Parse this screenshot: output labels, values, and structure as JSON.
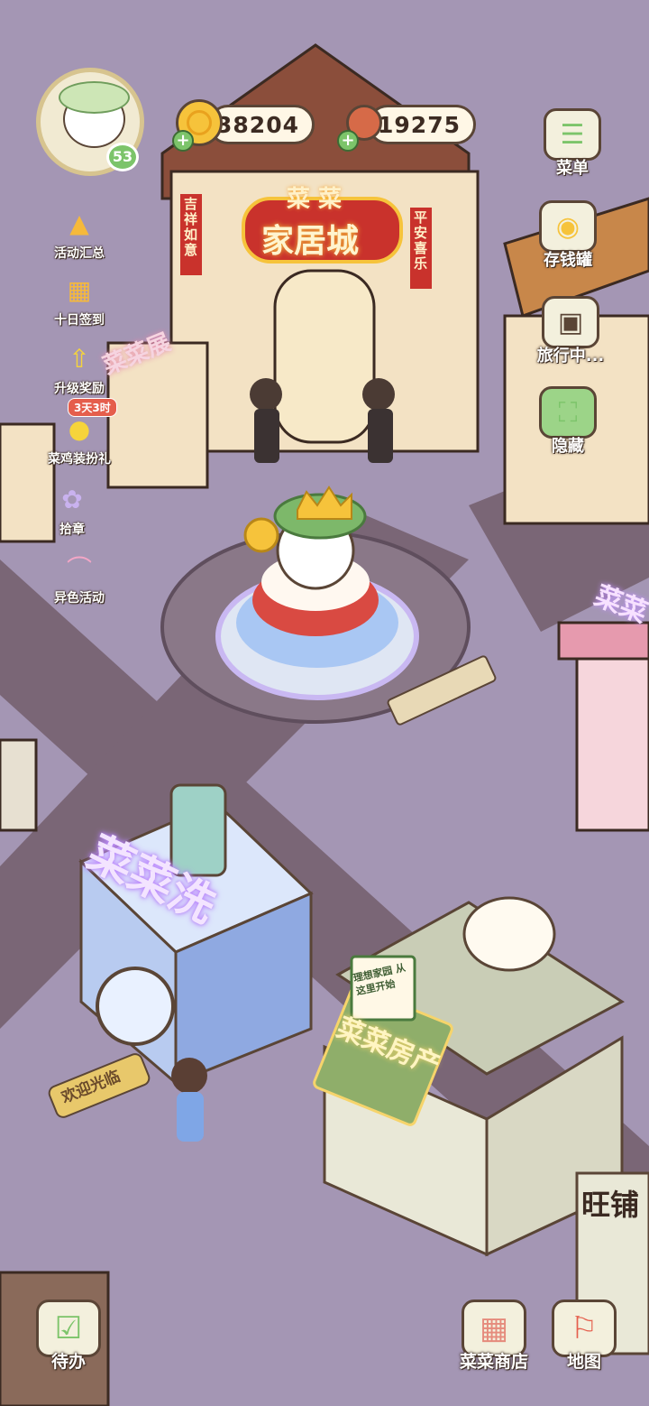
{
  "currency": {
    "coins": "38204",
    "meat": "19275"
  },
  "player": {
    "level": "53"
  },
  "left_menu": [
    {
      "label": "活动汇总",
      "icon": "event-summary-icon"
    },
    {
      "label": "十日签到",
      "icon": "checkin-calendar-icon"
    },
    {
      "label": "升级奖励",
      "icon": "upgrade-reward-icon"
    },
    {
      "label": "菜鸡装扮礼",
      "icon": "dressup-gift-icon",
      "badge": "3天3时"
    },
    {
      "label": "拾章",
      "icon": "badge-collect-icon"
    },
    {
      "label": "异色活动",
      "icon": "rainbow-event-icon"
    }
  ],
  "right_menu": [
    {
      "label": "菜单",
      "icon": "menu-icon"
    },
    {
      "label": "存钱罐",
      "icon": "piggy-bank-icon"
    },
    {
      "label": "旅行中...",
      "icon": "camera-icon"
    },
    {
      "label": "隐藏",
      "icon": "hide-icon"
    }
  ],
  "bottom_menu": {
    "todo": "待办",
    "shop": "菜菜商店",
    "map": "地图"
  },
  "signs": {
    "mall_top": "菜 菜",
    "mall_main": "家居城",
    "mall_left_banner": "吉祥如意",
    "mall_right_banner": "平安喜乐",
    "laundry": "菜菜洗",
    "welcome_mat": "欢迎光临",
    "realty": "菜菜房产",
    "realty_board": "理想家园 从这里开始",
    "right_shop": "菜菜",
    "corner_shop": "旺铺",
    "left_shop": "菜菜展"
  },
  "colors": {
    "ground": "#9b8eab",
    "path": "#6d5b6b",
    "accent_gold": "#f6c33b",
    "ui_border": "#5a4536"
  }
}
